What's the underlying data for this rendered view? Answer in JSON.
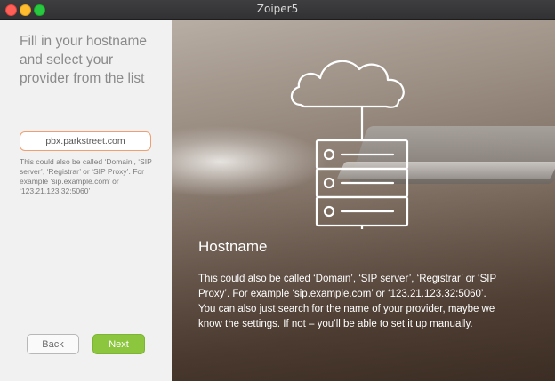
{
  "window": {
    "title": "Zoiper5"
  },
  "left_panel": {
    "heading": "Fill in your hostname and select your provider from the list",
    "hostname_value": "pbx.parkstreet.com",
    "hint": "This could also be called ‘Domain’, ‘SIP server’, ‘Registrar’ or ‘SIP Proxy’. For example ‘sip.example.com’ or ‘123.21.123.32:5060’",
    "back_label": "Back",
    "next_label": "Next"
  },
  "right_panel": {
    "title": "Hostname",
    "description_1": "This could also be called ‘Domain’, ‘SIP server’, ‘Registrar’ or ‘SIP Proxy’. For example ‘sip.example.com’ or ‘123.21.123.32:5060’.",
    "description_2": "You can also just search for the name of your provider, maybe we know the settings. If not – you’ll be able to set it up manually."
  },
  "colors": {
    "next_button": "#8cc63f",
    "input_border": "#f0a070"
  }
}
